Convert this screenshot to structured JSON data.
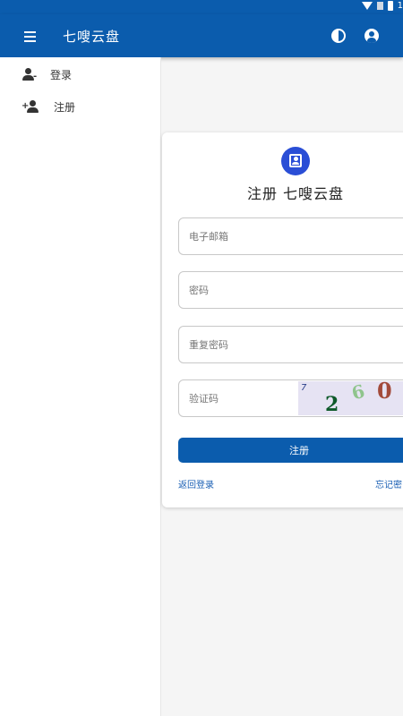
{
  "app": {
    "title": "七嗖云盘"
  },
  "status_bar": {
    "time": "1"
  },
  "drawer": {
    "items": [
      {
        "label": "登录",
        "icon": "login-icon"
      },
      {
        "label": "注册",
        "icon": "person-add-icon"
      }
    ]
  },
  "register": {
    "title": "注册 七嗖云盘",
    "email_placeholder": "电子邮箱",
    "password_placeholder": "密码",
    "repeat_password_placeholder": "重复密码",
    "captcha_placeholder": "验证码",
    "captcha": {
      "chars": [
        "2",
        "6",
        "0"
      ]
    },
    "submit_label": "注册",
    "back_to_login": "返回登录",
    "forgot_password": "忘记密"
  },
  "colors": {
    "primary": "#0b5cad",
    "badge": "#2a4ed6",
    "link": "#1a5fb4"
  }
}
